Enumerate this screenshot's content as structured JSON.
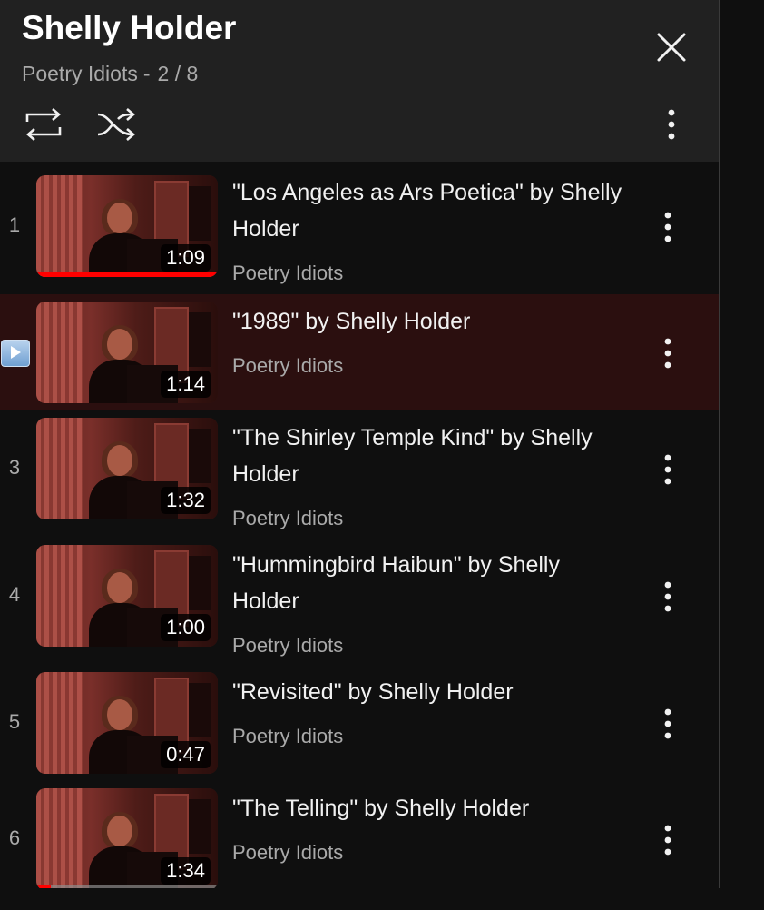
{
  "header": {
    "title": "Shelly Holder",
    "channel": "Poetry Idiots",
    "separator": "-",
    "position": "2 / 8",
    "icons": [
      "close-icon",
      "loop-icon",
      "shuffle-icon",
      "more-vert-icon"
    ]
  },
  "playlist": [
    {
      "index": "1",
      "title": "\"Los Angeles as Ars Poetica\" by Shelly Holder",
      "channel": "Poetry Idiots",
      "duration": "1:09",
      "watched_fraction": 1.0,
      "active": false
    },
    {
      "index": "",
      "title": "\"1989\" by Shelly Holder",
      "channel": "Poetry Idiots",
      "duration": "1:14",
      "watched_fraction": 0,
      "active": true
    },
    {
      "index": "3",
      "title": "\"The Shirley Temple Kind\" by Shelly Holder",
      "channel": "Poetry Idiots",
      "duration": "1:32",
      "watched_fraction": 0,
      "active": false
    },
    {
      "index": "4",
      "title": "\"Hummingbird Haibun\" by Shelly Holder",
      "channel": "Poetry Idiots",
      "duration": "1:00",
      "watched_fraction": 0,
      "active": false
    },
    {
      "index": "5",
      "title": "\"Revisited\" by Shelly Holder",
      "channel": "Poetry Idiots",
      "duration": "0:47",
      "watched_fraction": 0,
      "active": false
    },
    {
      "index": "6",
      "title": "\"The Telling\" by Shelly Holder",
      "channel": "Poetry Idiots",
      "duration": "1:34",
      "watched_fraction": 0.08,
      "active": false
    }
  ],
  "colors": {
    "active_row": "#2b0f0f",
    "progress": "#ff0000",
    "panel": "#212121"
  }
}
